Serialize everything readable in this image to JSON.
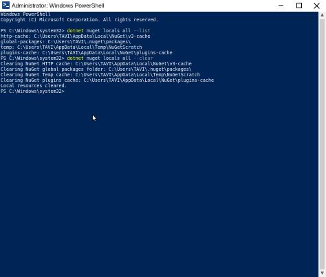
{
  "window": {
    "title": "Administrator: Windows PowerShell",
    "icon": "powershell-icon",
    "controls": [
      "minimize-icon",
      "maximize-icon",
      "close-icon"
    ]
  },
  "colors": {
    "console_background": "#012456",
    "console_text": "#eeedf0",
    "command": "#ffff00",
    "parameter": "#a0a0a0"
  },
  "console": {
    "banner": "Windows PowerShell",
    "copyright": "Copyright (C) Microsoft Corporation. All rights reserved.",
    "cmd1": {
      "prompt": "PS C:\\Windows\\system32> ",
      "command": "dotnet",
      "args": " nuget locals all ",
      "param": "--list"
    },
    "list_output": [
      "http-cache: C:\\Users\\TAVI\\AppData\\Local\\NuGet\\v3-cache",
      "global-packages: C:\\Users\\TAVI\\.nuget\\packages\\",
      "temp: C:\\Users\\TAVI\\AppData\\Local\\Temp\\NuGetScratch",
      "plugins-cache: C:\\Users\\TAVI\\AppData\\Local\\NuGet\\plugins-cache"
    ],
    "cmd2": {
      "prompt": "PS C:\\Windows\\system32> ",
      "command": "dotnet",
      "args": " nuget locals all ",
      "param": "--clear"
    },
    "clear_output": [
      "Clearing NuGet HTTP cache: C:\\Users\\TAVI\\AppData\\Local\\NuGet\\v3-cache",
      "Clearing NuGet global packages folder: C:\\Users\\TAVI\\.nuget\\packages\\",
      "Clearing NuGet Temp cache: C:\\Users\\TAVI\\AppData\\Local\\Temp\\NuGetScratch",
      "Clearing NuGet plugins cache: C:\\Users\\TAVI\\AppData\\Local\\NuGet\\plugins-cache",
      "Local resources cleared."
    ],
    "final_prompt": "PS C:\\Windows\\system32>"
  }
}
